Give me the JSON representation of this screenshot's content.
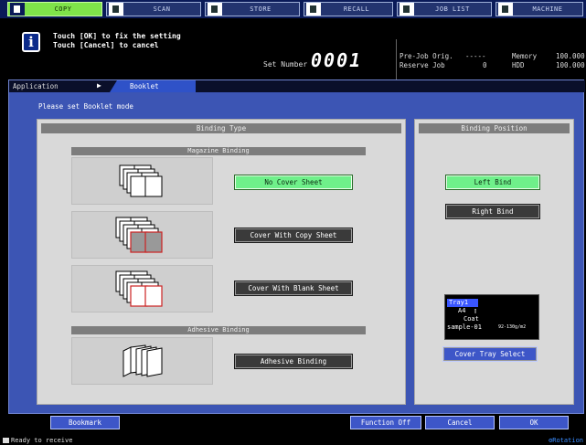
{
  "tabs": [
    {
      "label": "COPY",
      "icon": "copy-icon",
      "active": true
    },
    {
      "label": "SCAN",
      "icon": "scan-icon",
      "active": false
    },
    {
      "label": "STORE",
      "icon": "store-icon",
      "active": false
    },
    {
      "label": "RECALL",
      "icon": "recall-icon",
      "active": false
    },
    {
      "label": "JOB LIST",
      "icon": "job-list-icon",
      "active": false
    },
    {
      "label": "MACHINE",
      "icon": "machine-icon",
      "active": false
    }
  ],
  "message": {
    "line1": "Touch [OK] to fix the setting",
    "line2": "Touch [Cancel] to cancel"
  },
  "set_number": {
    "label": "Set Number",
    "value": "0001"
  },
  "status_panel": {
    "pre_job_label": "Pre-Job Orig.",
    "pre_job_value": "-----",
    "memory_label": "Memory",
    "memory_value": "100.000",
    "reserve_label": "Reserve Job",
    "reserve_value": "0",
    "hdd_label": "HDD",
    "hdd_value": "100.000"
  },
  "breadcrumb": {
    "application": "Application",
    "current": "Booklet"
  },
  "prompt": "Please set Booklet mode",
  "binding_type": {
    "header": "Binding Type",
    "magazine_header": "Magazine Binding",
    "adhesive_header": "Adhesive Binding",
    "no_cover": "No Cover Sheet",
    "cover_copy": "Cover With Copy Sheet",
    "cover_blank": "Cover With Blank Sheet",
    "adhesive": "Adhesive Binding",
    "selected": "No Cover Sheet"
  },
  "binding_position": {
    "header": "Binding Position",
    "left": "Left Bind",
    "right": "Right Bind",
    "selected": "Left Bind"
  },
  "tray": {
    "name": "Tray1",
    "size": "A4",
    "type": "Coat",
    "paper": "sample-01",
    "weight": "92-130g/m2",
    "select_button": "Cover Tray Select"
  },
  "footer": {
    "bookmark": "Bookmark",
    "function_off": "Function Off",
    "cancel": "Cancel",
    "ok": "OK"
  },
  "status_bar": {
    "text": "Ready to receive",
    "rotation": "Rotation"
  },
  "colors": {
    "active_tab": "#7fe34a",
    "selected_button": "#6ff08a",
    "panel_blue": "#3c55b4"
  }
}
